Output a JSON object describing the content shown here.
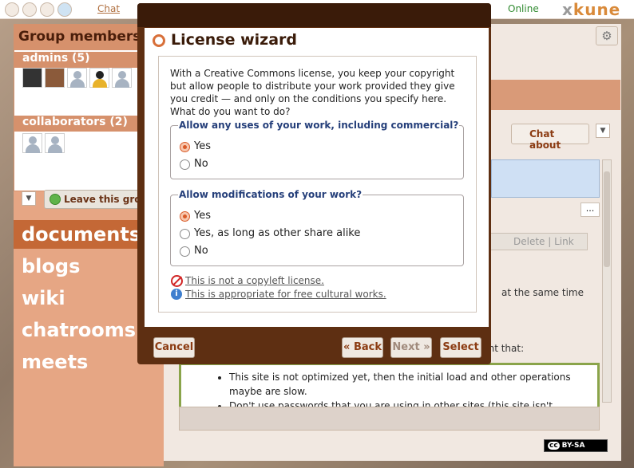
{
  "topbar": {
    "chat_label": "Chat",
    "status": "Online",
    "logo_prefix": "x",
    "logo_text": "kune"
  },
  "sidebar": {
    "title": "Group members",
    "admins_label": "admins (5)",
    "collaborators_label": "collaborators (2)",
    "leave_button": "Leave this group",
    "tools": [
      {
        "label": "documents",
        "active": true
      },
      {
        "label": "blogs",
        "active": false
      },
      {
        "label": "wiki",
        "active": false
      },
      {
        "label": "chatrooms",
        "active": false
      },
      {
        "label": "meets",
        "active": false
      }
    ]
  },
  "background": {
    "chat_about": "Chat about",
    "delete_link": "Delete | Link",
    "same_time": "at the same time",
    "count_that": "unt that:",
    "bullets": [
      "This site is not optimized yet, then the initial load and other operations maybe are slow.",
      "Don't use passwords that you are using in other sites (this site isn't"
    ],
    "license_badge": "BY-SA",
    "license_cc": "cc"
  },
  "dialog": {
    "title": "License wizard",
    "intro": "With a Creative Commons license, you keep your copyright but allow people to distribute your work provided they give you credit — and only on the conditions you specify here. What do you want to do?",
    "q1": {
      "legend": "Allow any uses of your work, including commercial?",
      "options": [
        "Yes",
        "No"
      ],
      "selected": 0
    },
    "q2": {
      "legend": "Allow modifications of your work?",
      "options": [
        "Yes",
        "Yes, as long as other share alike",
        "No"
      ],
      "selected": 0
    },
    "notes": {
      "copyleft": "This is not a copyleft license.",
      "free_cultural": "This is appropriate for free cultural works."
    },
    "buttons": {
      "cancel": "Cancel",
      "back": "« Back",
      "next": "Next »",
      "select": "Select"
    }
  },
  "colors": {
    "accent": "#c46836",
    "dialog_frame": "#5e2f12",
    "legend_blue": "#253f7a",
    "online_green": "#2f8a2f"
  }
}
